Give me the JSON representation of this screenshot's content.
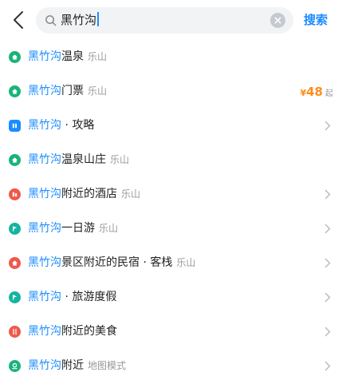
{
  "search": {
    "query": "黑竹沟",
    "button_label": "搜索"
  },
  "colors": {
    "accent": "#1a8cff",
    "price": "#ff8c1a",
    "icon_green": "#19b37a",
    "icon_blue": "#1a8cff",
    "icon_red": "#f0584a",
    "icon_teal": "#14b4a0"
  },
  "suggestions": [
    {
      "icon": "hot-spring-icon",
      "highlight": "黑竹沟",
      "main": "温泉",
      "city": "乐山",
      "has_chevron": false
    },
    {
      "icon": "ticket-icon",
      "highlight": "黑竹沟",
      "main": "门票",
      "city": "乐山",
      "has_chevron": false,
      "price_symbol": "¥",
      "price_value": "48",
      "price_suffix": "起"
    },
    {
      "icon": "guide-icon",
      "highlight": "黑竹沟",
      "main": " · 攻略",
      "city": "",
      "has_chevron": true
    },
    {
      "icon": "hot-spring-icon",
      "highlight": "黑竹沟",
      "main": "温泉山庄",
      "city": "乐山",
      "has_chevron": false
    },
    {
      "icon": "hotel-icon",
      "highlight": "黑竹沟",
      "main": "附近的酒店",
      "city": "乐山",
      "has_chevron": true
    },
    {
      "icon": "day-tour-flag-icon",
      "highlight": "黑竹沟",
      "main": "一日游",
      "city": "乐山",
      "has_chevron": true
    },
    {
      "icon": "homestay-icon",
      "highlight": "黑竹沟",
      "main": "景区附近的民宿 · 客栈",
      "city": "乐山",
      "has_chevron": true
    },
    {
      "icon": "vacation-flag-icon",
      "highlight": "黑竹沟",
      "main": " · 旅游度假",
      "city": "",
      "has_chevron": true
    },
    {
      "icon": "food-icon",
      "highlight": "黑竹沟",
      "main": "附近的美食",
      "city": "",
      "has_chevron": true
    },
    {
      "icon": "map-pin-icon",
      "highlight": "黑竹沟",
      "main": "附近",
      "city": "地图模式",
      "has_chevron": true
    }
  ]
}
